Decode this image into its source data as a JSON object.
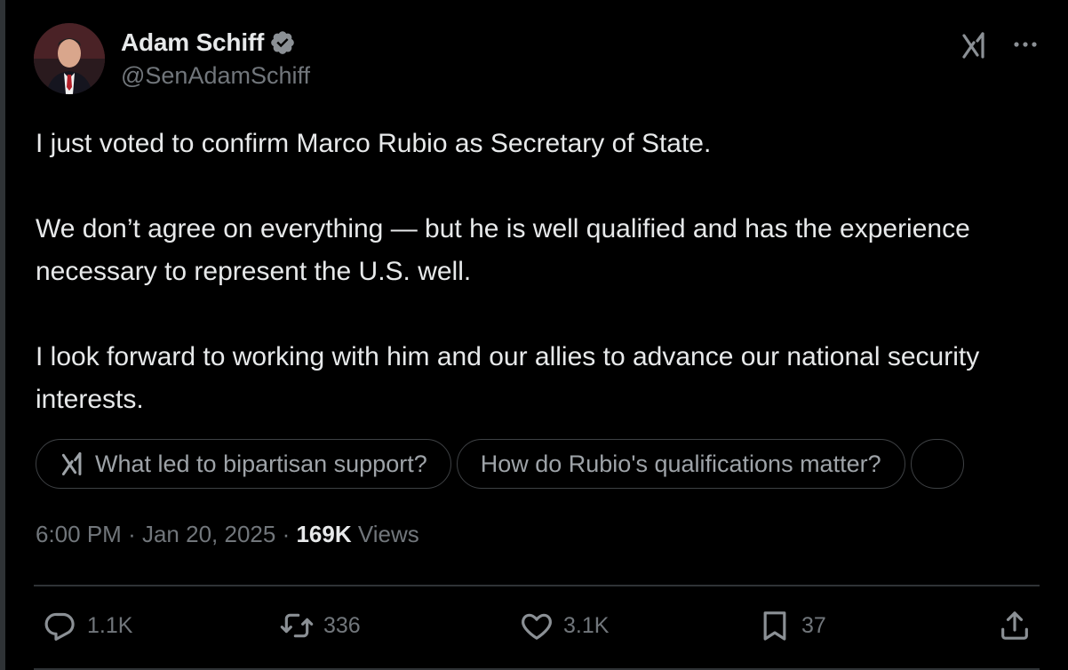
{
  "author": {
    "display_name": "Adam Schiff",
    "handle": "@SenAdamSchiff",
    "verified": true,
    "verified_color": "#71767b"
  },
  "tweet": {
    "paragraphs": [
      "I just voted to confirm Marco Rubio as Secretary of State.",
      "We don’t agree on everything — but he is well qualified and has the experience necessary to represent the U.S. well.",
      "I look forward to working with him and our allies to advance our national security interests."
    ]
  },
  "grok_prompts": [
    "What led to bipartisan support?",
    "How do Rubio's qualifications matter?"
  ],
  "meta": {
    "time": "6:00 PM",
    "separator": "·",
    "date": "Jan 20, 2025",
    "views_count": "169K",
    "views_label": "Views"
  },
  "actions": {
    "replies": "1.1K",
    "reposts": "336",
    "likes": "3.1K",
    "bookmarks": "37"
  },
  "icons": {
    "top_right": [
      "grok-icon",
      "more-icon"
    ],
    "actions": [
      "reply-icon",
      "repost-icon",
      "like-icon",
      "bookmark-icon",
      "share-icon"
    ]
  },
  "colors": {
    "background": "#000000",
    "text": "#e7e9ea",
    "secondary": "#71767b",
    "border": "#2f3336"
  }
}
